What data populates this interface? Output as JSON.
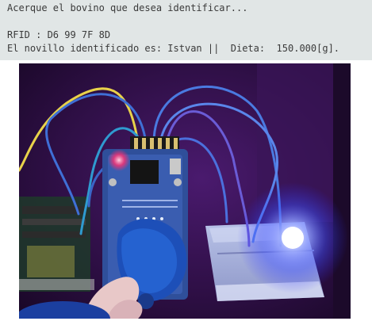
{
  "serial_monitor": {
    "line_prompt": "Acerque el bovino que desea identificar...",
    "line_rfid": "RFID : D6 99 7F 8D",
    "line_result": "El novillo identificado es: Istvan ||  Dieta:  150.000[g]."
  },
  "photo": {
    "subject": "rfid-reader-arduino-breadboard-blue-led",
    "colors": {
      "background": "#2a0c3e",
      "rfid_board": "#2f4f9a",
      "led_glow": "#5a6bff",
      "wire_blue": "#3f6fd6",
      "wire_yellow": "#e8d24a"
    }
  }
}
